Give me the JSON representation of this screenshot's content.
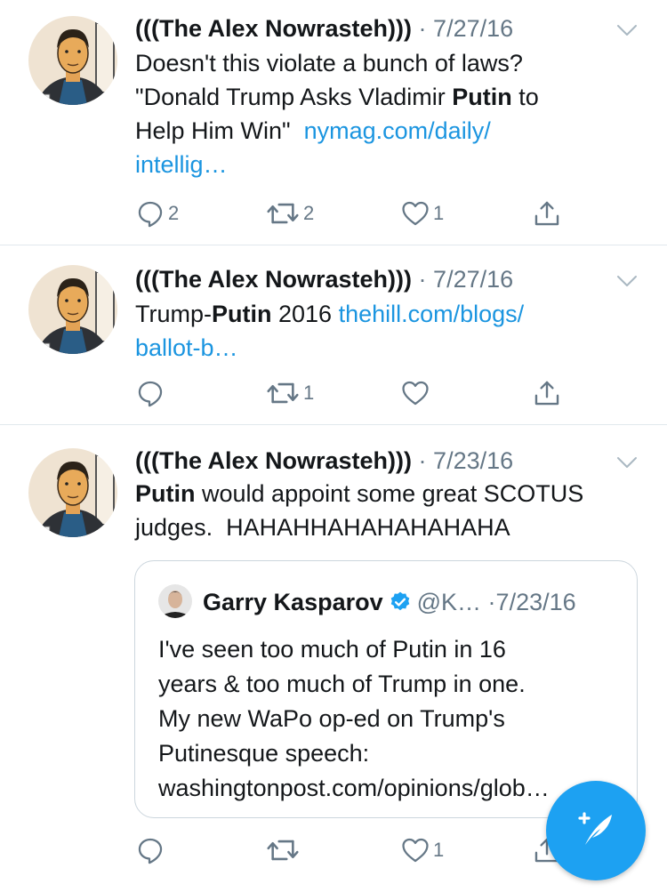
{
  "tweets": [
    {
      "name": "(((The Alex Nowrasteh)))",
      "date": "7/27/16",
      "text_lines": [
        {
          "parts": [
            {
              "t": "Doesn't this violate a bunch of laws?"
            }
          ]
        },
        {
          "parts": [
            {
              "t": "\"Donald Trump Asks Vladimir "
            },
            {
              "t": "Putin",
              "b": true
            },
            {
              "t": " to"
            }
          ]
        },
        {
          "parts": [
            {
              "t": "Help Him Win\"  "
            },
            {
              "t": "nymag.com/daily/",
              "link": true
            }
          ]
        },
        {
          "parts": [
            {
              "t": "intellig…",
              "link": true
            }
          ]
        }
      ],
      "counts": {
        "reply": "2",
        "retweet": "2",
        "like": "1"
      }
    },
    {
      "name": "(((The Alex Nowrasteh)))",
      "date": "7/27/16",
      "text_lines": [
        {
          "parts": [
            {
              "t": "Trump-"
            },
            {
              "t": "Putin",
              "b": true
            },
            {
              "t": " 2016 "
            },
            {
              "t": "thehill.com/blogs/",
              "link": true
            }
          ]
        },
        {
          "parts": [
            {
              "t": "ballot-b…",
              "link": true
            }
          ]
        }
      ],
      "counts": {
        "reply": "",
        "retweet": "1",
        "like": ""
      }
    },
    {
      "name": "(((The Alex Nowrasteh)))",
      "date": "7/23/16",
      "text_lines": [
        {
          "parts": [
            {
              "t": "Putin",
              "b": true
            },
            {
              "t": " would appoint some great SCOTUS"
            }
          ]
        },
        {
          "parts": [
            {
              "t": "judges.  HAHAHHAHAHAHAHAHA"
            }
          ]
        }
      ],
      "counts": {
        "reply": "",
        "retweet": "",
        "like": "1"
      }
    }
  ],
  "quote": {
    "name": "Garry Kasparov",
    "handle": "@K…",
    "date": "7/23/16",
    "lines": [
      "I've seen too much of Putin in 16",
      "years & too much of Trump in one.",
      "My new WaPo op-ed on Trump's",
      "Putinesque speech:",
      "washingtonpost.com/opinions/glob…"
    ]
  },
  "separator": "·",
  "icons": {
    "reply": "reply-icon",
    "retweet": "retweet-icon",
    "like": "heart-icon",
    "share": "share-icon",
    "menu": "chevron-down-icon",
    "compose": "compose-tweet-icon",
    "verified": "verified-badge-icon"
  },
  "colors": {
    "link": "#1b95e0",
    "muted": "#657786",
    "accent": "#1da1f2"
  }
}
